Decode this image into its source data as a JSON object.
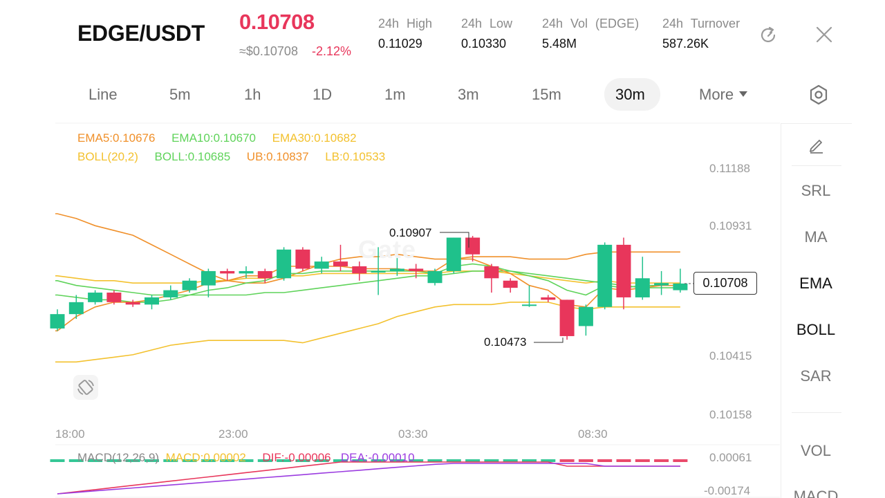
{
  "header": {
    "pair": "EDGE/USDT",
    "price": "0.10708",
    "usd_price": "≈$0.10708",
    "change": "-2.12%",
    "stats": [
      {
        "label": "24h High",
        "value": "0.11029"
      },
      {
        "label": "24h Low",
        "value": "0.10330"
      },
      {
        "label": "24h Vol (EDGE)",
        "value": "5.48M"
      },
      {
        "label": "24h Turnover",
        "value": "587.26K"
      }
    ],
    "colors": {
      "down": "#e8365b",
      "up": "#1fc18b"
    }
  },
  "toolbar": {
    "timeframes": [
      "Line",
      "5m",
      "1h",
      "1D",
      "1m",
      "3m",
      "15m",
      "30m"
    ],
    "active": "30m",
    "more_label": "More"
  },
  "side_panel": {
    "items": [
      "SRL",
      "MA",
      "EMA",
      "BOLL",
      "SAR"
    ],
    "items_lower": [
      "VOL",
      "MACD"
    ]
  },
  "legends": {
    "ema5": "EMA5:0.10676",
    "ema10": "EMA10:0.10670",
    "ema30": "EMA30:0.10682",
    "boll_params": "BOLL(20,2)",
    "boll": "BOLL:0.10685",
    "ub": "UB:0.10837",
    "lb": "LB:0.10533",
    "macd_params": "MACD(12,26,9)",
    "macd": "MACD:0.00002",
    "dif": "DIF:-0.00006",
    "dea": "DEA:-0.00010",
    "colors": {
      "ema5": "#f0902a",
      "ema10": "#5fd35a",
      "ema30": "#f3c12e",
      "macd": "#f3c12e",
      "dif": "#e8365b",
      "dea": "#9b3ce0"
    }
  },
  "chart_data": {
    "type": "candlestick",
    "y_ticks": [
      "0.11188",
      "0.10931",
      "0.10415",
      "0.10158"
    ],
    "x_ticks": [
      "18:00",
      "23:00",
      "03:30",
      "08:30"
    ],
    "current_price": "0.10708",
    "max_annotation": "0.10907",
    "min_annotation": "0.10473",
    "macd_ticks": [
      "0.00061",
      "-0.00174"
    ],
    "ylim": [
      0.10158,
      0.11188
    ],
    "candles": [
      {
        "o": 0.1052,
        "c": 0.1058,
        "h": 0.106,
        "l": 0.1051
      },
      {
        "o": 0.1058,
        "c": 0.1063,
        "h": 0.1066,
        "l": 0.1056
      },
      {
        "o": 0.1063,
        "c": 0.1067,
        "h": 0.1068,
        "l": 0.1062
      },
      {
        "o": 0.1067,
        "c": 0.1063,
        "h": 0.1068,
        "l": 0.1062
      },
      {
        "o": 0.1063,
        "c": 0.1062,
        "h": 0.1064,
        "l": 0.1061
      },
      {
        "o": 0.1062,
        "c": 0.1065,
        "h": 0.1066,
        "l": 0.106
      },
      {
        "o": 0.1065,
        "c": 0.1068,
        "h": 0.107,
        "l": 0.1064
      },
      {
        "o": 0.1068,
        "c": 0.1072,
        "h": 0.1073,
        "l": 0.1067
      },
      {
        "o": 0.107,
        "c": 0.1076,
        "h": 0.1077,
        "l": 0.1065
      },
      {
        "o": 0.1076,
        "c": 0.1075,
        "h": 0.1077,
        "l": 0.1072
      },
      {
        "o": 0.1075,
        "c": 0.1076,
        "h": 0.1078,
        "l": 0.1073
      },
      {
        "o": 0.1076,
        "c": 0.1073,
        "h": 0.1077,
        "l": 0.1071
      },
      {
        "o": 0.1073,
        "c": 0.1085,
        "h": 0.1086,
        "l": 0.1072
      },
      {
        "o": 0.1085,
        "c": 0.1077,
        "h": 0.1086,
        "l": 0.1076
      },
      {
        "o": 0.1077,
        "c": 0.108,
        "h": 0.1082,
        "l": 0.1075
      },
      {
        "o": 0.108,
        "c": 0.1078,
        "h": 0.1087,
        "l": 0.1076
      },
      {
        "o": 0.1078,
        "c": 0.1075,
        "h": 0.108,
        "l": 0.1072
      },
      {
        "o": 0.1076,
        "c": 0.1076,
        "h": 0.1086,
        "l": 0.1066
      },
      {
        "o": 0.1076,
        "c": 0.1077,
        "h": 0.1082,
        "l": 0.1074
      },
      {
        "o": 0.1077,
        "c": 0.1076,
        "h": 0.1079,
        "l": 0.1073
      },
      {
        "o": 0.1071,
        "c": 0.1076,
        "h": 0.1077,
        "l": 0.107
      },
      {
        "o": 0.1076,
        "c": 0.109,
        "h": 0.109,
        "l": 0.1075
      },
      {
        "o": 0.109,
        "c": 0.1083,
        "h": 0.10907,
        "l": 0.108
      },
      {
        "o": 0.1078,
        "c": 0.1073,
        "h": 0.1079,
        "l": 0.1067
      },
      {
        "o": 0.1072,
        "c": 0.1069,
        "h": 0.1073,
        "l": 0.1067
      },
      {
        "o": 0.1062,
        "c": 0.1062,
        "h": 0.107,
        "l": 0.1061
      },
      {
        "o": 0.1065,
        "c": 0.1064,
        "h": 0.1066,
        "l": 0.1063
      },
      {
        "o": 0.1064,
        "c": 0.10488,
        "h": 0.1064,
        "l": 0.10473
      },
      {
        "o": 0.1053,
        "c": 0.1061,
        "h": 0.1062,
        "l": 0.1049
      },
      {
        "o": 0.1061,
        "c": 0.1087,
        "h": 0.1088,
        "l": 0.106
      },
      {
        "o": 0.1087,
        "c": 0.1065,
        "h": 0.109,
        "l": 0.106
      },
      {
        "o": 0.1065,
        "c": 0.1073,
        "h": 0.1082,
        "l": 0.1064
      },
      {
        "o": 0.107,
        "c": 0.1071,
        "h": 0.1076,
        "l": 0.1066
      },
      {
        "o": 0.1068,
        "c": 0.10708,
        "h": 0.1077,
        "l": 0.1067
      }
    ],
    "ub": [
      0.11,
      0.1098,
      0.1095,
      0.1093,
      0.1091,
      0.1087,
      0.1083,
      0.1079,
      0.1075,
      0.1072,
      0.1071,
      0.1071,
      0.1073,
      0.1076,
      0.1079,
      0.1081,
      0.1082,
      0.1082,
      0.1083,
      0.1082,
      0.1081,
      0.1081,
      0.1082,
      0.1082,
      0.1082,
      0.1081,
      0.1081,
      0.1081,
      0.1083,
      0.1084,
      0.1084,
      0.1084,
      0.1084,
      0.1084
    ],
    "boll_mid": [
      0.1072,
      0.107,
      0.1069,
      0.1068,
      0.1067,
      0.1066,
      0.1066,
      0.1066,
      0.1066,
      0.1066,
      0.1066,
      0.1067,
      0.1067,
      0.1068,
      0.1069,
      0.107,
      0.1071,
      0.1072,
      0.1073,
      0.1074,
      0.1074,
      0.1075,
      0.1076,
      0.1076,
      0.1076,
      0.1075,
      0.1074,
      0.1073,
      0.1072,
      0.1071,
      0.107,
      0.1069,
      0.1069,
      0.1069
    ],
    "lb": [
      0.1038,
      0.1038,
      0.1039,
      0.104,
      0.1041,
      0.1043,
      0.1045,
      0.1046,
      0.1047,
      0.1047,
      0.1047,
      0.1047,
      0.1047,
      0.1046,
      0.1048,
      0.105,
      0.1052,
      0.1054,
      0.1057,
      0.1059,
      0.1061,
      0.1062,
      0.1062,
      0.1062,
      0.1063,
      0.1063,
      0.1063,
      0.1061,
      0.106,
      0.1061,
      0.1061,
      0.1061,
      0.1061,
      0.1061
    ],
    "ema5": [
      0.1051,
      0.1057,
      0.1061,
      0.1063,
      0.1063,
      0.1064,
      0.1066,
      0.1068,
      0.1071,
      0.1072,
      0.1074,
      0.1074,
      0.1078,
      0.1078,
      0.1078,
      0.1078,
      0.1077,
      0.1077,
      0.1077,
      0.1076,
      0.1076,
      0.1081,
      0.1081,
      0.1078,
      0.1075,
      0.107,
      0.1068,
      0.1062,
      0.1061,
      0.1069,
      0.1068,
      0.1069,
      0.107,
      0.107
    ],
    "ema10": [
      0.1066,
      0.1065,
      0.1064,
      0.1064,
      0.1063,
      0.1063,
      0.1064,
      0.1066,
      0.1068,
      0.1069,
      0.1071,
      0.1072,
      0.1075,
      0.1075,
      0.1076,
      0.1076,
      0.1076,
      0.1076,
      0.1076,
      0.1076,
      0.1075,
      0.1078,
      0.1079,
      0.1078,
      0.1076,
      0.1074,
      0.1072,
      0.1068,
      0.1066,
      0.107,
      0.1069,
      0.107,
      0.107,
      0.107
    ],
    "ema30": [
      0.1074,
      0.1073,
      0.1072,
      0.1072,
      0.1071,
      0.1071,
      0.1071,
      0.1071,
      0.1072,
      0.1072,
      0.1073,
      0.1073,
      0.1074,
      0.1074,
      0.1075,
      0.1075,
      0.1075,
      0.1075,
      0.1075,
      0.1075,
      0.1075,
      0.1076,
      0.1076,
      0.1076,
      0.1075,
      0.1074,
      0.1073,
      0.1072,
      0.1071,
      0.1072,
      0.1071,
      0.1071,
      0.1071,
      0.1071
    ]
  }
}
